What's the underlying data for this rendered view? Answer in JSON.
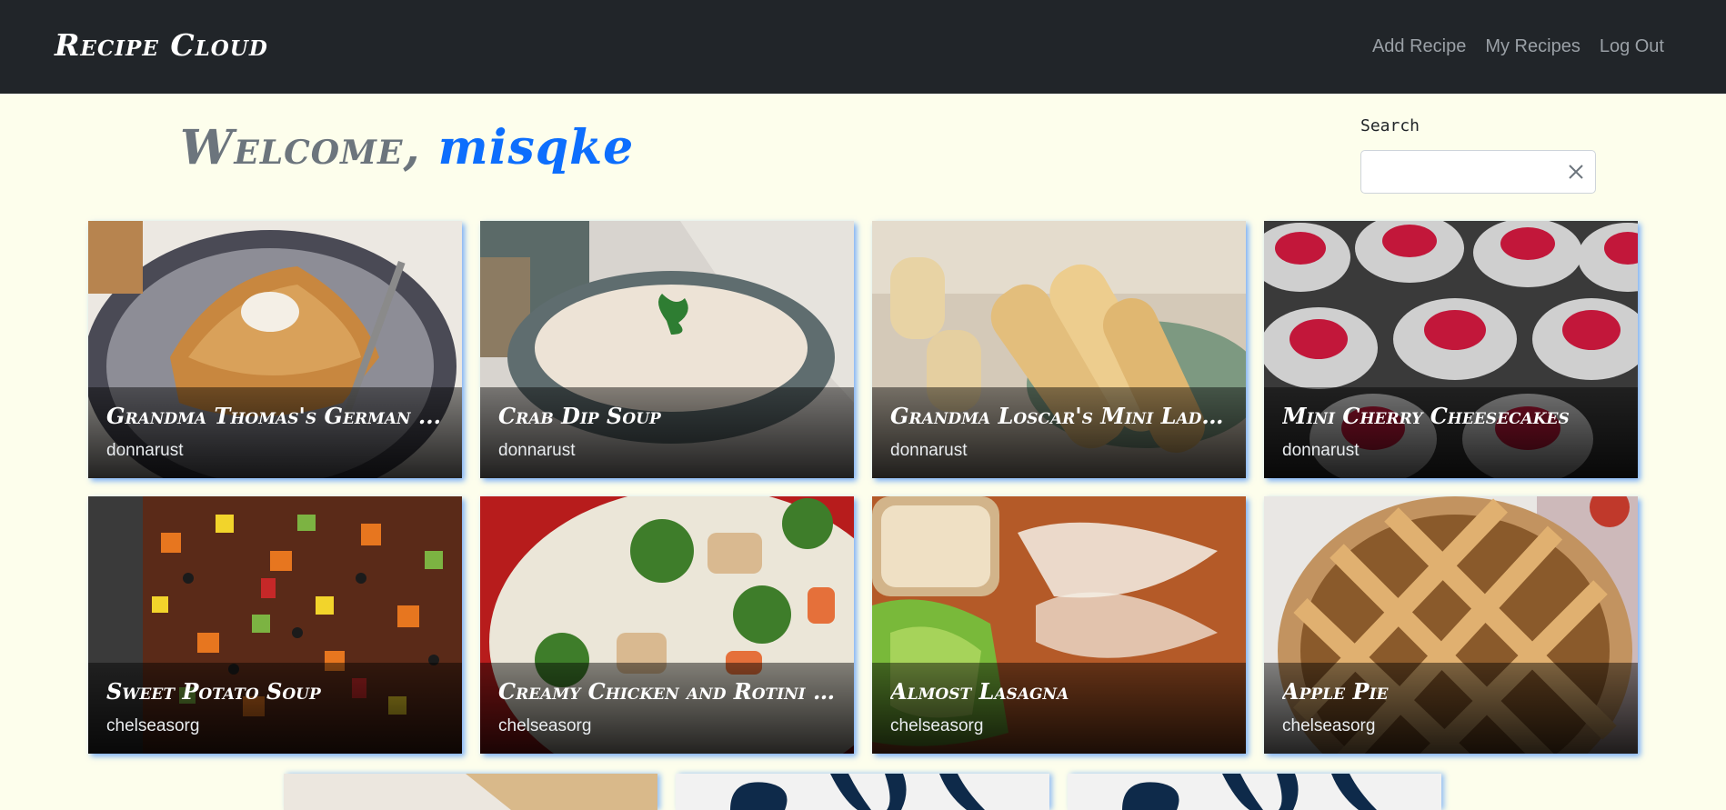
{
  "navbar": {
    "brand": "Recipe Cloud",
    "links": [
      "Add Recipe",
      "My Recipes",
      "Log Out"
    ]
  },
  "welcome": {
    "prefix": "Welcome,",
    "username": "misqke"
  },
  "search": {
    "label": "Search",
    "value": "",
    "placeholder": ""
  },
  "recipes": [
    {
      "title": "Grandma Thomas's German ...",
      "author": "donnarust"
    },
    {
      "title": "Crab Dip Soup",
      "author": "donnarust"
    },
    {
      "title": "Grandma Loscar's Mini Lady...",
      "author": "donnarust"
    },
    {
      "title": "Mini Cherry Cheesecakes",
      "author": "donnarust"
    },
    {
      "title": "Sweet Potato Soup",
      "author": "chelseasorg"
    },
    {
      "title": "Creamy Chicken and Rotini P...",
      "author": "chelseasorg"
    },
    {
      "title": "Almost Lasagna",
      "author": "chelseasorg"
    },
    {
      "title": "Apple Pie",
      "author": "chelseasorg"
    }
  ],
  "icons": {
    "clear": "close-icon",
    "placeholder_image": "vegetable-icon"
  },
  "colors": {
    "navbar": "#212529",
    "accent": "#0d6efd",
    "background": "#fdfeec"
  }
}
